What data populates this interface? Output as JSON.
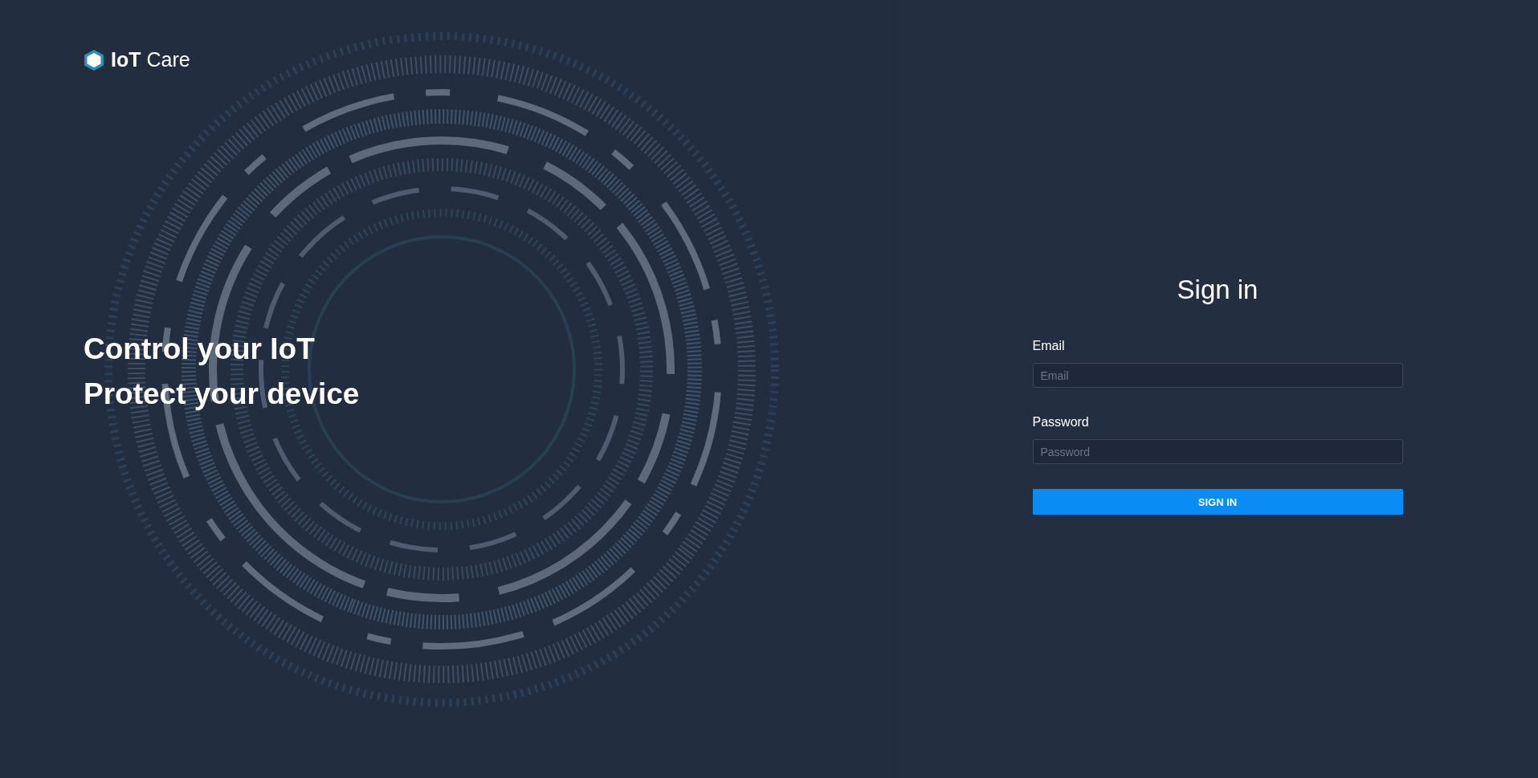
{
  "brand": {
    "name": "**IoT** Care"
  },
  "hero": {
    "lines": [
      "Control your IoT",
      "Protect your device"
    ]
  },
  "sign_in": {
    "title": "Sign in",
    "fields": [
      {
        "label": "Email",
        "placeholder": "Email"
      },
      {
        "label": "Password",
        "placeholder": "Password"
      }
    ],
    "button": "SIGN IN"
  }
}
